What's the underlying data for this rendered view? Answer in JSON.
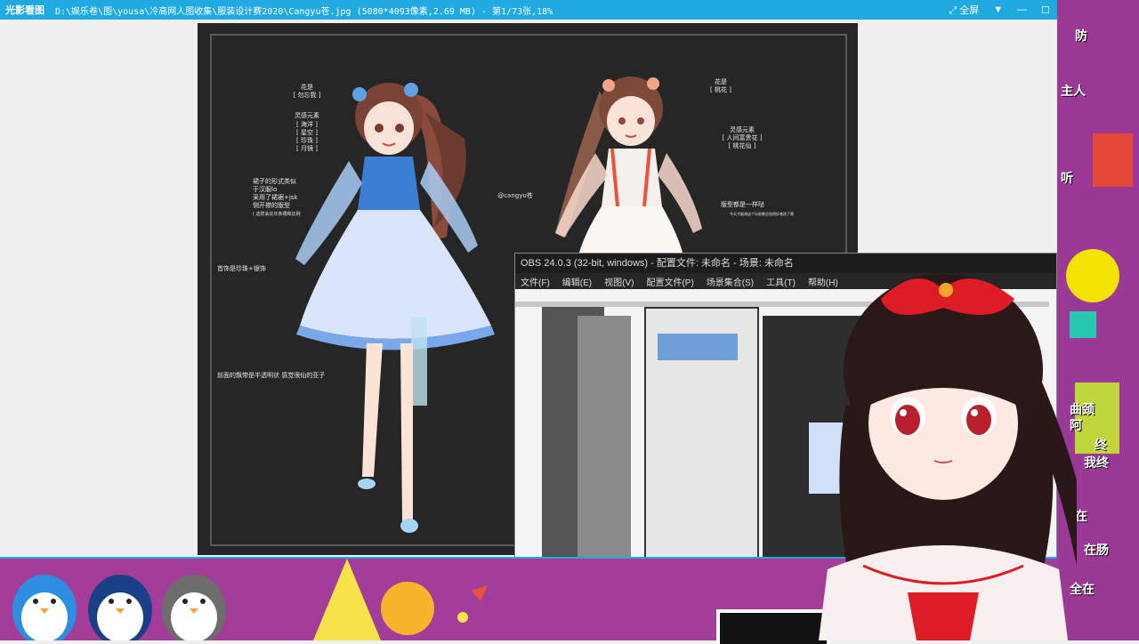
{
  "titlebar": {
    "app_name": "光影看图",
    "path": "D:\\娱乐卷\\图\\yousa\\冷高网人图收集\\服装设计赛2020\\Cangyu苍.jpg (5080*4093像素,2.69 MB) - 第1/73张,18%",
    "fullscreen_label": "全屏",
    "menu_label": "▼",
    "minimize_label": "—",
    "maximize_label": "☐"
  },
  "artwork": {
    "left_notes": {
      "flower_title": "花是",
      "flower_value": "[ 勿忘我 ]",
      "inspiration_title": "灵感元素",
      "inspiration_items": [
        "[ 海洋 ]",
        "[ 星空 ]",
        "[ 珍珠 ]",
        "[ 月镜 ]"
      ],
      "style_note_1": "裙子的形式类似",
      "style_note_2": "于汉服lo",
      "style_note_3": "采用了裙裾+jsk",
      "style_note_4": "侧开襟的版型",
      "style_small": "( 这样会比长条裙和比例",
      "jewelry_note": "首饰是珍珠+银饰",
      "ribbon_note": "前面的飘带是半透明状 感觉很仙的亚子"
    },
    "right_notes": {
      "flower_title": "花是",
      "flower_value": "[ 桃花 ]",
      "inspiration_title": "灵感元素",
      "inspiration_items": [
        "[ 人间富贵花 ]",
        "[ 桃花仙 ]"
      ],
      "style_note": "版型都是一样哒",
      "style_small": "今天才能调这个坑祝晚总觉得好难改了哦"
    },
    "signature": "@cangyu苍"
  },
  "obs": {
    "title": "OBS 24.0.3 (32-bit, windows) - 配置文件: 未命名 - 场景: 未命名",
    "menu": [
      "文件(F)",
      "编辑(E)",
      "视图(V)",
      "配置文件(P)",
      "场景集合(S)",
      "工具(T)",
      "帮助(H)"
    ]
  },
  "stream_comments": [
    "防",
    "主人",
    "听",
    "曲颈",
    "阿",
    "终",
    "我终",
    "在",
    "在肠",
    "全在"
  ],
  "colors": {
    "titlebar": "#21a9e1",
    "stream_bg": "#9b3a96",
    "bottom_bg": "#a23d9a"
  }
}
